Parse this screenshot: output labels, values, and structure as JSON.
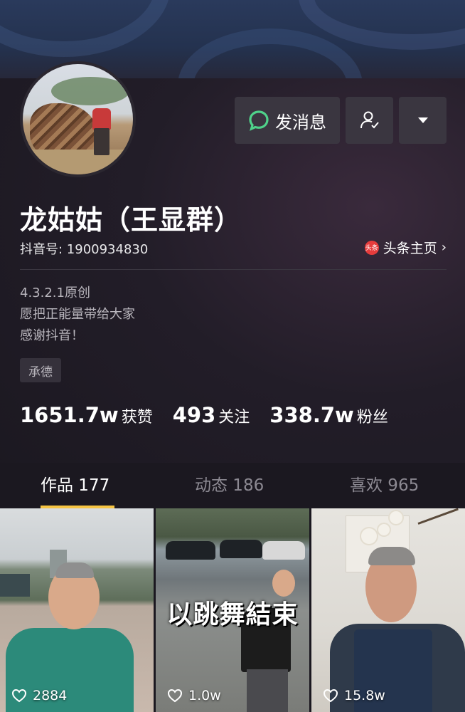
{
  "profile": {
    "name": "龙姑姑（王显群）",
    "douyin_id": "抖音号: 1900934830",
    "toutiao_badge": "头条",
    "toutiao_link": "头条主页",
    "bio_lines": [
      "4.3.2.1原创",
      "愿把正能量带给大家",
      "感谢抖音！"
    ],
    "tag": "承德"
  },
  "actions": {
    "message_label": "发消息",
    "follow_icon": "user-check-icon",
    "more_icon": "triangle-down-icon"
  },
  "stats": [
    {
      "num": "1651.7w",
      "label": "获赞"
    },
    {
      "num": "493",
      "label": "关注"
    },
    {
      "num": "338.7w",
      "label": "粉丝"
    }
  ],
  "tabs": [
    {
      "label": "作品 177",
      "active": true
    },
    {
      "label": "动态 186",
      "active": false
    },
    {
      "label": "喜欢 965",
      "active": false
    }
  ],
  "videos": [
    {
      "likes": "2884"
    },
    {
      "likes": "1.0w",
      "overlay": "以跳舞結束"
    },
    {
      "likes": "15.8w"
    }
  ],
  "colors": {
    "accent": "#f6c443",
    "message_icon": "#4fd28a",
    "background": "#1b1820",
    "button": "#3a3640"
  }
}
